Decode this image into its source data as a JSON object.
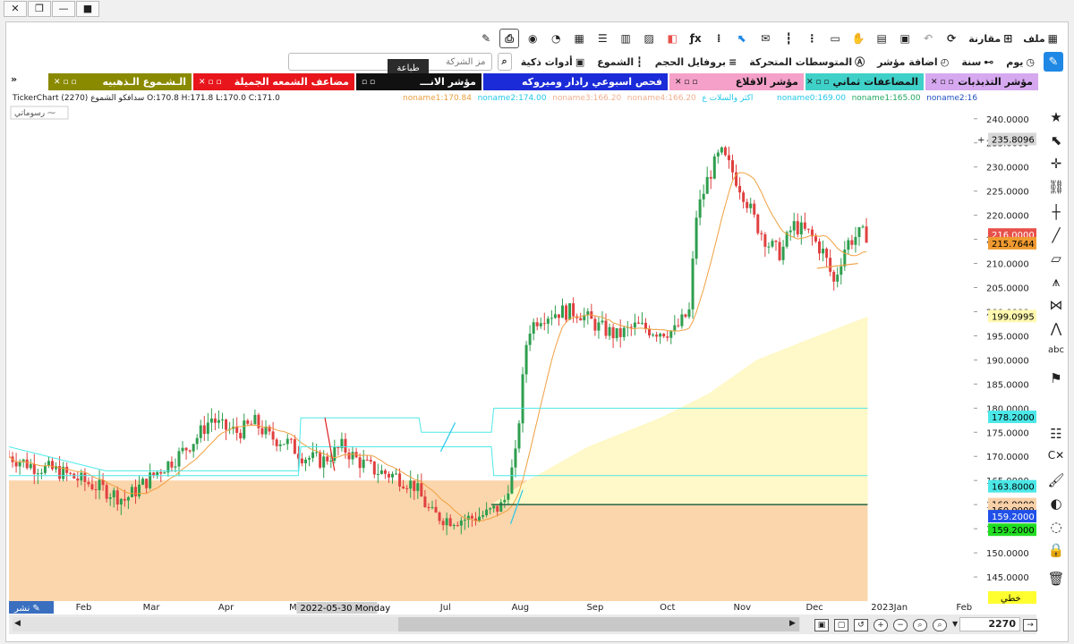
{
  "window": {
    "controls": [
      "close",
      "restore",
      "minimize",
      "record"
    ]
  },
  "toolbar": {
    "file": "ملف",
    "compare": "مقارنة",
    "tooltip_print": "طباعة"
  },
  "row2": {
    "day": "يوم",
    "year": "سنة",
    "add_indicator": "اضافة مؤشر",
    "moving_averages": "المتوسطات المتحركة",
    "volume_profile": "بروفايل الحجم",
    "candles": "الشموع",
    "smart_tools": "أدوات ذكية",
    "search_placeholder": "مز الشركة",
    "search_prefix": "اد"
  },
  "tabs": [
    {
      "label": "مؤشر التذبذبات",
      "color": "#d6a8f0"
    },
    {
      "label": "المضاعفات ثماني",
      "color": "#3fd0c8"
    },
    {
      "label": "مؤشر الاقلاع",
      "color": "#f4a0c8"
    },
    {
      "label": "فحص اسبوعي رادار وميروكه",
      "color": "#1b2bd8"
    },
    {
      "label": "مؤشر الانـــ",
      "color": "#111111"
    },
    {
      "label": "مضاعف الشمعه الجميلة",
      "color": "#e8161c"
    },
    {
      "label": "الـشـموع الـذهبيه",
      "color": "#8a8a00"
    }
  ],
  "chart_info": {
    "ticker": "TickerChart",
    "symbol_line": "(2270) سدافكو الشموع O:170.8 H:171.8 L:170.0 C:171.0",
    "indicator_legend": [
      {
        "text": "noname1:170.84",
        "color": "#e8a040"
      },
      {
        "text": "noname2:174.00",
        "color": "#22c8e8"
      },
      {
        "text": "noname3:166.20",
        "color": "#f0b090"
      },
      {
        "text": "noname4:166.20",
        "color": "#f0b090"
      },
      {
        "text": "اكثر والسلات ع",
        "color": "#22c8e8"
      },
      {
        "text": "noname0:169.00",
        "color": "#22c8e8"
      },
      {
        "text": "noname1:165.00",
        "color": "#22a860"
      },
      {
        "text": "noname2:16",
        "color": "#2050c0"
      }
    ],
    "drawings_label": "رسوماتي"
  },
  "chart_data": {
    "type": "candlestick",
    "ylim": [
      140,
      242
    ],
    "y_ticks": [
      145,
      150,
      155,
      160,
      165,
      170,
      175,
      180,
      185,
      190,
      195,
      200,
      205,
      210,
      215,
      220,
      225,
      230,
      235,
      240
    ],
    "x_labels": [
      "Feb",
      "Mar",
      "Apr",
      "May",
      "Jul",
      "Aug",
      "Sep",
      "Oct",
      "Nov",
      "Dec",
      "2023Jan",
      "Feb"
    ],
    "x_label_positions_days": [
      31,
      59,
      90,
      120,
      181,
      212,
      243,
      273,
      304,
      334,
      365,
      396
    ],
    "x_range_days": [
      0,
      400
    ],
    "last_day": 356,
    "crosshair_date": "2022-05-30 Monday",
    "price_badges": [
      {
        "value": "235.8096",
        "bg": "#d8d8d8",
        "fg": "#000"
      },
      {
        "value": "216.0000",
        "bg": "#e8504a",
        "fg": "#fff"
      },
      {
        "value": "215.7644",
        "bg": "#f09a30",
        "fg": "#000"
      },
      {
        "value": "199.0995",
        "bg": "#fff8b0",
        "fg": "#000"
      },
      {
        "value": "178.2000",
        "bg": "#4ce8e8",
        "fg": "#000"
      },
      {
        "value": "163.8000",
        "bg": "#4ce8e8",
        "fg": "#000"
      },
      {
        "value": "160.0000",
        "bg": "#f8d0a8",
        "fg": "#000"
      },
      {
        "value": "160.0000",
        "bg": "#f8d0a8",
        "fg": "#000"
      },
      {
        "value": "159.2000",
        "bg": "#2050e8",
        "fg": "#fff"
      },
      {
        "value": "159.2000",
        "bg": "#22dd22",
        "fg": "#000"
      }
    ],
    "bottom_badge": "خطي",
    "anchors": [
      [
        0,
        170
      ],
      [
        10,
        168
      ],
      [
        20,
        167
      ],
      [
        30,
        165
      ],
      [
        40,
        163
      ],
      [
        48,
        161
      ],
      [
        55,
        164
      ],
      [
        62,
        167
      ],
      [
        70,
        170
      ],
      [
        78,
        174
      ],
      [
        84,
        178
      ],
      [
        88,
        176
      ],
      [
        95,
        175
      ],
      [
        102,
        177
      ],
      [
        108,
        174
      ],
      [
        115,
        173
      ],
      [
        122,
        170
      ],
      [
        130,
        169
      ],
      [
        138,
        172
      ],
      [
        145,
        169
      ],
      [
        152,
        167
      ],
      [
        160,
        166
      ],
      [
        168,
        164
      ],
      [
        175,
        158
      ],
      [
        182,
        157
      ],
      [
        190,
        157
      ],
      [
        198,
        158
      ],
      [
        205,
        160
      ],
      [
        210,
        170
      ],
      [
        215,
        196
      ],
      [
        220,
        199
      ],
      [
        228,
        200
      ],
      [
        236,
        200
      ],
      [
        244,
        197
      ],
      [
        252,
        195
      ],
      [
        260,
        197
      ],
      [
        268,
        196
      ],
      [
        276,
        196
      ],
      [
        282,
        200
      ],
      [
        285,
        220
      ],
      [
        290,
        228
      ],
      [
        295,
        233
      ],
      [
        300,
        229
      ],
      [
        305,
        224
      ],
      [
        310,
        218
      ],
      [
        315,
        214
      ],
      [
        320,
        212
      ],
      [
        325,
        218
      ],
      [
        332,
        216
      ],
      [
        338,
        212
      ],
      [
        342,
        206
      ],
      [
        347,
        214
      ],
      [
        352,
        216
      ],
      [
        356,
        216
      ]
    ],
    "ma_line_color": "#f0a040",
    "cyan_line_color": "#4ce8e8",
    "orange_zone_top": 165,
    "orange_zone_bottom": 140,
    "orange_zone_color": "#fbd5ab",
    "yellow_zone_color": "#fff8c8"
  },
  "bottom": {
    "share_label": "نشر",
    "count": "2270"
  }
}
